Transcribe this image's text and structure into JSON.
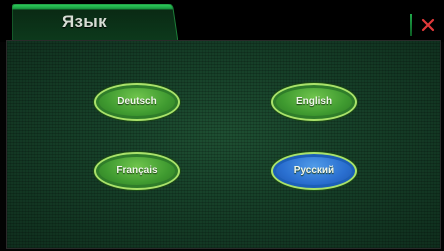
{
  "window": {
    "tab_title": "Язык",
    "close_glyph": "✕"
  },
  "languages": {
    "deutsch": "Deutsch",
    "english": "English",
    "francais": "Français",
    "russian": "Русский",
    "selected": "Русский"
  },
  "icons": {
    "close": "close-icon"
  },
  "colors": {
    "tab_green": "#1fa84a",
    "button_green": "#3f9a30",
    "button_selected_blue": "#2a6fd0",
    "close_red": "#e0393a",
    "panel_background": "#163f28"
  }
}
